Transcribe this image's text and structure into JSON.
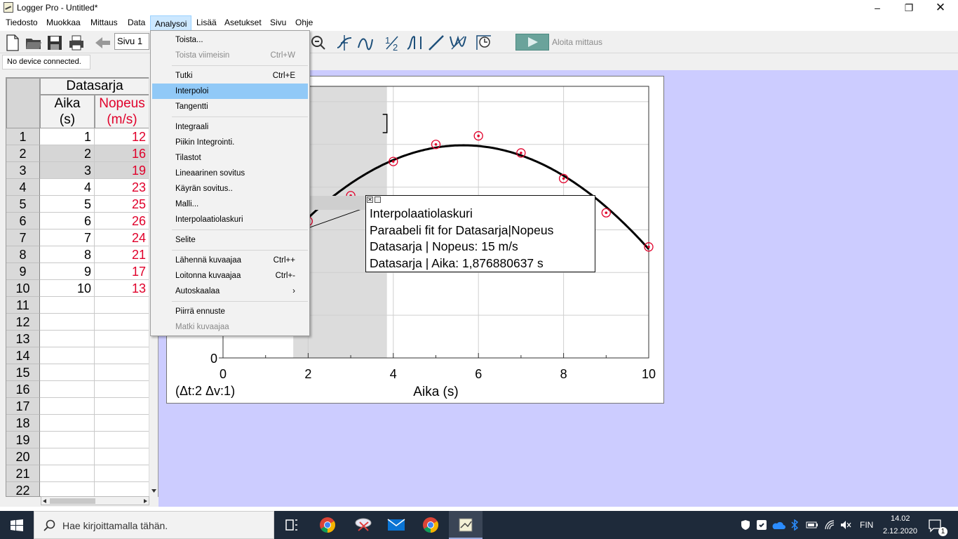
{
  "window": {
    "title": "Logger Pro - Untitled*"
  },
  "menubar": [
    "Tiedosto",
    "Muokkaa",
    "Mittaus",
    "Data",
    "Analysoi",
    "Lisää",
    "Asetukset",
    "Sivu",
    "Ohje"
  ],
  "toolbar": {
    "page": "Sivu 1",
    "start_label": "Aloita mittaus"
  },
  "status": {
    "device": "No device connected."
  },
  "table": {
    "dataset": "Datasarja",
    "col1": {
      "name": "Aika",
      "unit": "(s)"
    },
    "col2": {
      "name": "Nopeus",
      "unit": "(m/s)"
    },
    "rows": [
      [
        "1",
        "1",
        "12"
      ],
      [
        "2",
        "2",
        "16"
      ],
      [
        "3",
        "3",
        "19"
      ],
      [
        "4",
        "4",
        "23"
      ],
      [
        "5",
        "5",
        "25"
      ],
      [
        "6",
        "6",
        "26"
      ],
      [
        "7",
        "7",
        "24"
      ],
      [
        "8",
        "8",
        "21"
      ],
      [
        "9",
        "9",
        "17"
      ],
      [
        "10",
        "10",
        "13"
      ],
      [
        "11",
        "",
        ""
      ],
      [
        "12",
        "",
        ""
      ],
      [
        "13",
        "",
        ""
      ],
      [
        "14",
        "",
        ""
      ],
      [
        "15",
        "",
        ""
      ],
      [
        "16",
        "",
        ""
      ],
      [
        "17",
        "",
        ""
      ],
      [
        "18",
        "",
        ""
      ],
      [
        "19",
        "",
        ""
      ],
      [
        "20",
        "",
        ""
      ],
      [
        "21",
        "",
        ""
      ],
      [
        "22",
        "",
        ""
      ]
    ],
    "selected_rows": [
      2,
      3
    ]
  },
  "analysoi_menu": [
    {
      "label": "Toista...",
      "shortcut": ""
    },
    {
      "label": "Toista viimeisin",
      "shortcut": "Ctrl+W",
      "disabled": true
    },
    {
      "sep": true
    },
    {
      "label": "Tutki",
      "shortcut": "Ctrl+E"
    },
    {
      "label": "Interpoloi",
      "shortcut": "",
      "highlight": true
    },
    {
      "label": "Tangentti",
      "shortcut": ""
    },
    {
      "sep": true
    },
    {
      "label": "Integraali",
      "shortcut": ""
    },
    {
      "label": "Piikin Integrointi.",
      "shortcut": ""
    },
    {
      "label": "Tilastot",
      "shortcut": ""
    },
    {
      "label": "Lineaarinen sovitus",
      "shortcut": ""
    },
    {
      "label": "Käyrän sovitus..",
      "shortcut": ""
    },
    {
      "label": "Malli...",
      "shortcut": ""
    },
    {
      "label": "Interpolaatiolaskuri",
      "shortcut": ""
    },
    {
      "sep": true
    },
    {
      "label": "Selite",
      "shortcut": ""
    },
    {
      "sep": true
    },
    {
      "label": "Lähennä kuvaajaa",
      "shortcut": "Ctrl++"
    },
    {
      "label": "Loitonna kuvaajaa",
      "shortcut": "Ctrl+-"
    },
    {
      "label": "Autoskaalaa",
      "shortcut": "›"
    },
    {
      "sep": true
    },
    {
      "label": "Piirrä ennuste",
      "shortcut": ""
    },
    {
      "label": "Matki kuvaajaa",
      "shortcut": "",
      "disabled": true
    }
  ],
  "graph": {
    "xlabel": "Aika (s)",
    "delta": "(Δt:2 Δv:1)",
    "tooltip": [
      "Interpolaatiolaskuri",
      "Paraabeli fit for Datasarja|Nopeus",
      "Datasarja | Nopeus: 15 m/s",
      "Datasarja | Aika: 1,876880637 s"
    ]
  },
  "chart_data": {
    "type": "scatter",
    "x": [
      1,
      2,
      3,
      4,
      5,
      6,
      7,
      8,
      9,
      10
    ],
    "y": [
      12,
      16,
      19,
      23,
      25,
      26,
      24,
      21,
      17,
      13
    ],
    "xlabel": "Aika (s)",
    "ylabel": "",
    "xlim": [
      0,
      10
    ],
    "xticks": [
      "0",
      "2",
      "4",
      "6",
      "8",
      "10"
    ],
    "yticks_visible": [
      "0"
    ],
    "fit": "parabola",
    "selection_x": [
      1.65,
      3.85
    ],
    "marker_color": "#e0002a"
  },
  "taskbar": {
    "search": "Hae kirjoittamalla tähän.",
    "lang": "FIN",
    "time": "14.02",
    "date": "2.12.2020",
    "notif": "1"
  }
}
